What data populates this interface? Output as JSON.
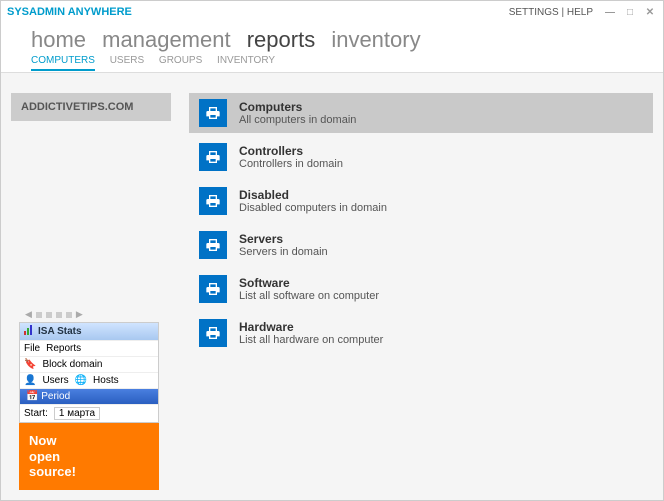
{
  "title": "SYSADMIN ANYWHERE",
  "header_links": {
    "settings": "SETTINGS",
    "help": "HELP"
  },
  "main_nav": {
    "home": "home",
    "management": "management",
    "reports": "reports",
    "inventory": "inventory"
  },
  "sub_nav": {
    "computers": "COMPUTERS",
    "users": "USERS",
    "groups": "GROUPS",
    "inventory": "INVENTORY"
  },
  "domain_label": "ADDICTIVETIPS.COM",
  "reports": [
    {
      "title": "Computers",
      "desc": "All computers in domain"
    },
    {
      "title": "Controllers",
      "desc": "Controllers in domain"
    },
    {
      "title": "Disabled",
      "desc": "Disabled computers in domain"
    },
    {
      "title": "Servers",
      "desc": "Servers in domain"
    },
    {
      "title": "Software",
      "desc": "List all software on computer"
    },
    {
      "title": "Hardware",
      "desc": "List all hardware on computer"
    }
  ],
  "widget": {
    "title": "ISA Stats",
    "menu_file": "File",
    "menu_reports": "Reports",
    "block": "Block domain",
    "users": "Users",
    "hosts": "Hosts",
    "period": "Period",
    "start_label": "Start:",
    "start_value": "1 марта"
  },
  "promo": {
    "line1": "Now",
    "line2": "open",
    "line3": "source!"
  }
}
